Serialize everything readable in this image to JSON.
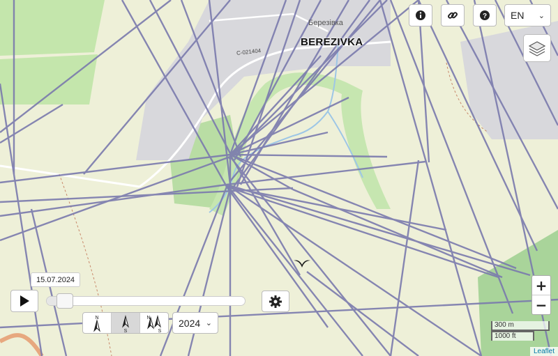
{
  "map": {
    "place_name": "BEREZIVKA",
    "place_local_name": "Березівка",
    "road_ref": "C-021404",
    "attribution": "Leaflet"
  },
  "toolbar": {
    "info_icon": "info-icon",
    "link_icon": "link-icon",
    "help_icon": "help-icon",
    "language": "EN",
    "layers_icon": "layers-icon"
  },
  "zoom": {
    "in_label": "+",
    "out_label": "−"
  },
  "scale": {
    "metric": "300 m",
    "imperial": "1000 ft"
  },
  "playback": {
    "date": "15.07.2024",
    "progress": 0.05,
    "play_icon": "play-icon",
    "settings_icon": "gear-icon",
    "year": "2024"
  },
  "orientation": {
    "options": [
      {
        "label_top": "N",
        "label_bottom": "",
        "icon": "north-arrow-icon",
        "active": false
      },
      {
        "label_top": "",
        "label_bottom": "S",
        "icon": "south-arrow-icon",
        "active": true
      },
      {
        "label_top": "N",
        "label_bottom": "S",
        "icon": "north-south-arrows-icon",
        "active": false
      }
    ]
  },
  "colors": {
    "track": "#7a7aad",
    "background": "#eef0d8",
    "residential": "#d9d9dc",
    "park": "#c3e3a8",
    "forest": "#b5daa0",
    "water": "#9dc6e6"
  }
}
